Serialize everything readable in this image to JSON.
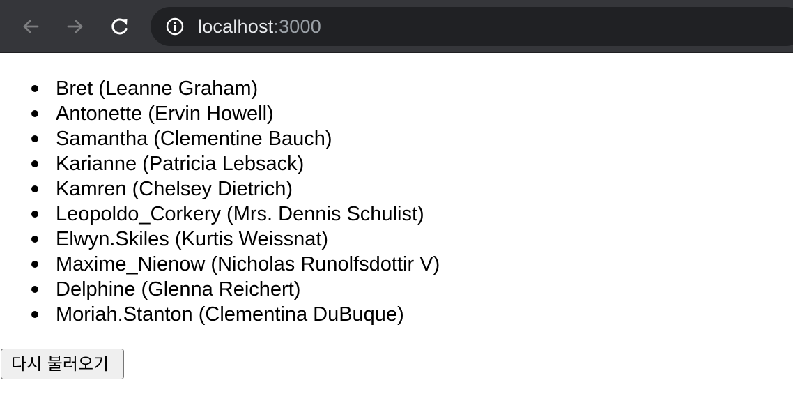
{
  "browser": {
    "url_host": "localhost",
    "url_port": ":3000",
    "back_icon": "arrow-left-icon",
    "forward_icon": "arrow-right-icon",
    "reload_icon": "reload-icon",
    "site_info_icon": "info-icon"
  },
  "users": [
    {
      "username": "Bret",
      "name": "Leanne Graham"
    },
    {
      "username": "Antonette",
      "name": "Ervin Howell"
    },
    {
      "username": "Samantha",
      "name": "Clementine Bauch"
    },
    {
      "username": "Karianne",
      "name": "Patricia Lebsack"
    },
    {
      "username": "Kamren",
      "name": "Chelsey Dietrich"
    },
    {
      "username": "Leopoldo_Corkery",
      "name": "Mrs. Dennis Schulist"
    },
    {
      "username": "Elwyn.Skiles",
      "name": "Kurtis Weissnat"
    },
    {
      "username": "Maxime_Nienow",
      "name": "Nicholas Runolfsdottir V"
    },
    {
      "username": "Delphine",
      "name": "Glenna Reichert"
    },
    {
      "username": "Moriah.Stanton",
      "name": "Clementina DuBuque"
    }
  ],
  "reload_button_label": "다시 불러오기"
}
